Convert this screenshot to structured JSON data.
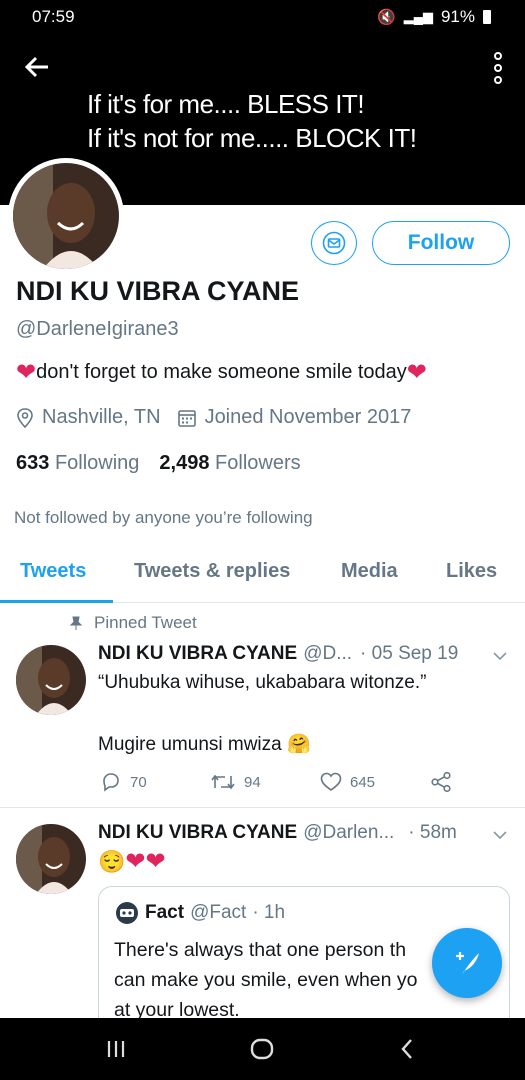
{
  "status_bar": {
    "time": "07:59",
    "battery": "91%"
  },
  "banner": {
    "line1": "If it's for me.... BLESS IT!",
    "line2": "If it's not for me..... BLOCK IT!"
  },
  "profile": {
    "follow_label": "Follow",
    "name": "NDI KU VIBRA CYANE",
    "handle": "@DarleneIgirane3",
    "bio": "don't forget to make someone smile today",
    "location": "Nashville, TN",
    "joined": "Joined November 2017",
    "following_count": "633",
    "following_label": "Following",
    "followers_count": "2,498",
    "followers_label": "Followers",
    "not_followed": "Not followed by anyone you’re following"
  },
  "tabs": [
    "Tweets",
    "Tweets & replies",
    "Media",
    "Likes"
  ],
  "tweets": [
    {
      "pinned_label": "Pinned Tweet",
      "name": "NDI KU VIBRA CYANE",
      "handle": "@D...",
      "time": "· 05 Sep 19",
      "text1": "“Uhubuka wihuse, ukababara witonze.”",
      "text2": "Mugire umunsi mwiza",
      "replies": "70",
      "retweets": "94",
      "likes": "645"
    },
    {
      "name": "NDI KU VIBRA CYANE",
      "handle": "@Darlen...",
      "time": "· 58m",
      "quote": {
        "name": "Fact",
        "handle": "@Fact",
        "time": "· 1h",
        "line1": "There's always that one person th",
        "line2": "can make you smile, even when yo",
        "line3": "at your lowest."
      }
    }
  ],
  "colors": {
    "accent": "#1da1f2",
    "heart": "#e0245e",
    "muted": "#657786"
  }
}
